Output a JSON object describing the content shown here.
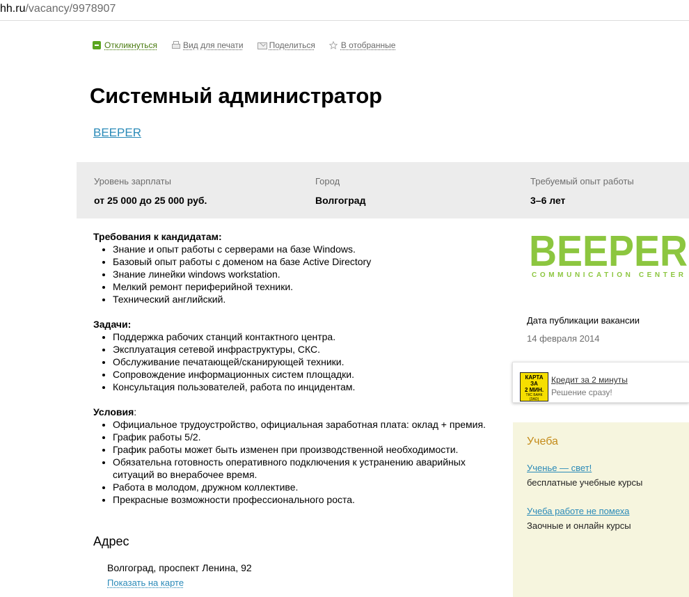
{
  "url": {
    "host": "hh.ru",
    "path": "/vacancy/9978907"
  },
  "toolbar": {
    "respond": "Откликнуться",
    "print": "Вид для печати",
    "share": "Поделиться",
    "favorite": "В отобранные"
  },
  "vacancy": {
    "title": "Системный администратор",
    "company": "BEEPER"
  },
  "info": {
    "salary_label": "Уровень зарплаты",
    "salary_value": "от 25 000 до 25 000 руб.",
    "city_label": "Город",
    "city_value": "Волгоград",
    "exp_label": "Требуемый опыт работы",
    "exp_value": "3–6 лет"
  },
  "description": {
    "requirements_title": "Требования к кандидатам:",
    "requirements": [
      "Знание и опыт работы с серверами на базе Windows.",
      "Базовый опыт работы с доменом на базе Active Directory",
      "Знание линейки windows workstation.",
      "Мелкий ремонт периферийной техники.",
      "Технический английский."
    ],
    "tasks_title": "Задачи:",
    "tasks": [
      "Поддержка рабочих станций контактного центра.",
      "Эксплуатация сетевой инфраструктуры, СКС.",
      "Обслуживание печатающей/сканирующей техники.",
      "Сопровождение информационных систем площадки.",
      "Консультация пользователей, работа по инцидентам."
    ],
    "conditions_title": "Условия",
    "conditions_colon": ":",
    "conditions": [
      "Официальное трудоустройство, официальная заработная плата: оклад + премия.",
      "График работы 5/2.",
      "График работы может быть изменен при производственной необходимости.",
      "Обязательна готовность оперативного подключения к устранению аварийных ситуаций во внерабочее время.",
      "Работа в молодом, дружном коллективе.",
      "Прекрасные возможности профессионального роста."
    ]
  },
  "address": {
    "title": "Адрес",
    "text": "Волгоград, проспект Ленина, 92",
    "map_link": "Показать на карте"
  },
  "logo": {
    "word": "BEEPER",
    "tagline": "COMMUNICATION CENTER",
    "color": "#8cc63f",
    "icon": "beeper-logo"
  },
  "publication": {
    "label": "Дата публикации вакансии",
    "date": "14 февраля 2014"
  },
  "ad": {
    "card_line1": "КАРТА ЗА",
    "card_line2": "2 МИН.",
    "card_bank": "ТКС БАНК",
    "card_bank2": "(ЗАО)",
    "link": "Кредит за 2 минуты",
    "sub": "Решение сразу!"
  },
  "study": {
    "title": "Учеба",
    "items": [
      {
        "link": "Ученье — свет!",
        "sub": "бесплатные учебные курсы"
      },
      {
        "link": "Учеба работе не помеха",
        "sub": "Заочные и онлайн курсы"
      }
    ]
  }
}
